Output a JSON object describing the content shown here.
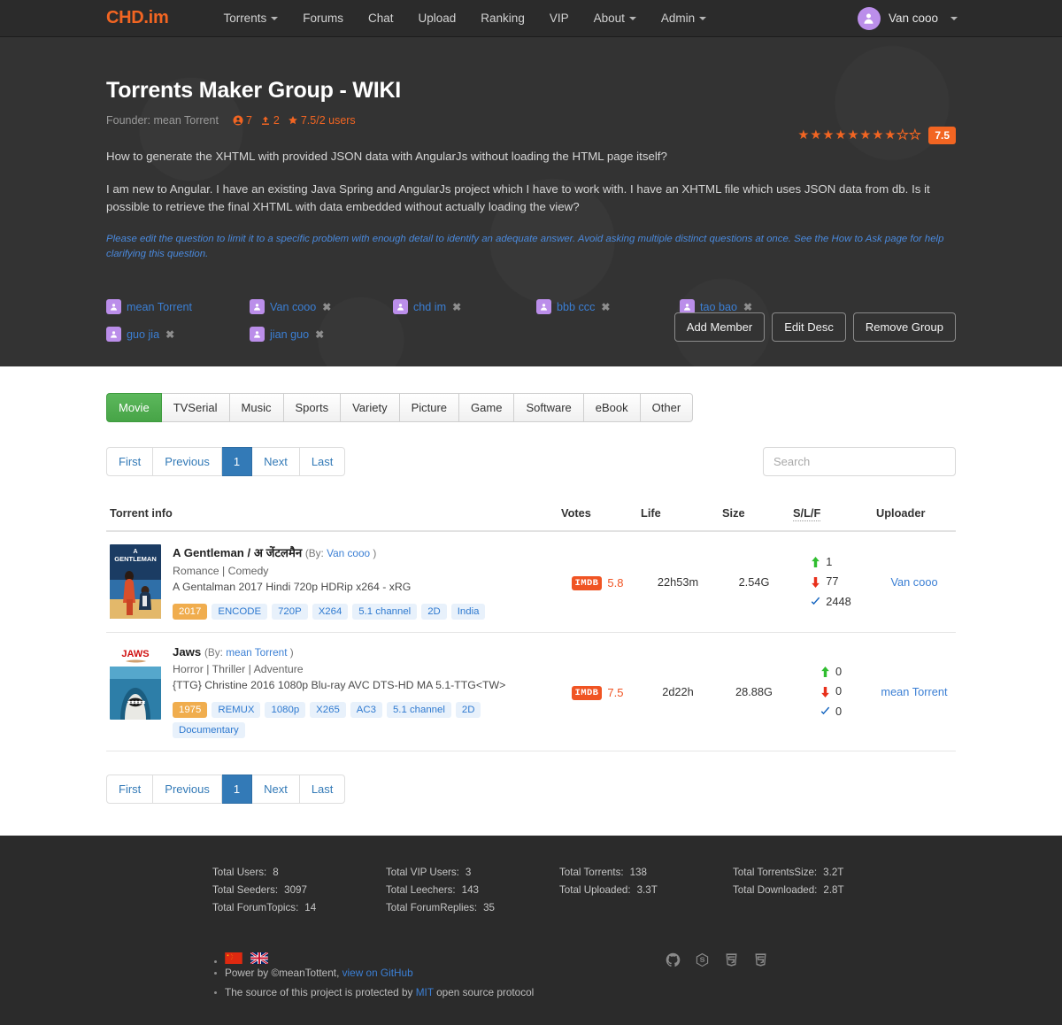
{
  "navbar": {
    "brand": "CHD.im",
    "links": [
      {
        "label": "Torrents",
        "caret": true
      },
      {
        "label": "Forums",
        "caret": false
      },
      {
        "label": "Chat",
        "caret": false
      },
      {
        "label": "Upload",
        "caret": false
      },
      {
        "label": "Ranking",
        "caret": false
      },
      {
        "label": "VIP",
        "caret": false
      },
      {
        "label": "About",
        "caret": true
      },
      {
        "label": "Admin",
        "caret": true
      }
    ],
    "user": "Van cooo",
    "user_icon": "user-icon",
    "accent_color": "#f26522"
  },
  "hero": {
    "title": "Torrents Maker Group - WIKI",
    "founder_label": "Founder: mean Torrent",
    "stats": [
      {
        "icon": "members-icon",
        "value": "7"
      },
      {
        "icon": "upload-icon",
        "value": "2"
      },
      {
        "icon": "star-icon",
        "value": "7.5/2 users"
      }
    ],
    "rating": {
      "filled": 8,
      "empty": 2,
      "score": "7.5"
    },
    "paragraph1": "How to generate the XHTML with provided JSON data with AngularJs without loading the HTML page itself?",
    "paragraph2": "I am new to Angular. I have an existing Java Spring and AngularJs project which I have to work with. I have an XHTML file which uses JSON data from db. Is it possible to retrieve the final XHTML with data embedded without actually loading the view?",
    "note": "Please edit the question to limit it to a specific problem with enough detail to identify an adequate answer. Avoid asking multiple distinct questions at once. See the How to Ask page for help clarifying this question.",
    "members": [
      {
        "name": "mean Torrent",
        "removable": false
      },
      {
        "name": "Van cooo",
        "removable": true
      },
      {
        "name": "chd im",
        "removable": true
      },
      {
        "name": "bbb ccc",
        "removable": true
      },
      {
        "name": "tao bao",
        "removable": true
      },
      {
        "name": "guo jia",
        "removable": true
      },
      {
        "name": "jian guo",
        "removable": true
      }
    ],
    "actions": [
      {
        "label": "Add Member"
      },
      {
        "label": "Edit Desc"
      },
      {
        "label": "Remove Group"
      }
    ]
  },
  "categories": {
    "tabs": [
      {
        "label": "Movie",
        "active": true
      },
      {
        "label": "TVSerial",
        "active": false
      },
      {
        "label": "Music",
        "active": false
      },
      {
        "label": "Sports",
        "active": false
      },
      {
        "label": "Variety",
        "active": false
      },
      {
        "label": "Picture",
        "active": false
      },
      {
        "label": "Game",
        "active": false
      },
      {
        "label": "Software",
        "active": false
      },
      {
        "label": "eBook",
        "active": false
      },
      {
        "label": "Other",
        "active": false
      }
    ]
  },
  "pager": [
    {
      "label": "First",
      "active": false
    },
    {
      "label": "Previous",
      "active": false
    },
    {
      "label": "1",
      "active": true
    },
    {
      "label": "Next",
      "active": false
    },
    {
      "label": "Last",
      "active": false
    }
  ],
  "search": {
    "placeholder": "Search",
    "value": ""
  },
  "table": {
    "headers": {
      "info": "Torrent info",
      "votes": "Votes",
      "life": "Life",
      "size": "Size",
      "slf": "S/L/F",
      "uploader": "Uploader"
    },
    "rows": [
      {
        "poster": "a-gentleman-poster",
        "title": "A Gentleman / अ जेंटलमैन",
        "by_prefix": "(By:",
        "by_user": "Van cooo",
        "by_suffix": ")",
        "genres": "Romance | Comedy",
        "filename": "A Gentalman 2017 Hindi 720p HDRip x264 - xRG",
        "tags": [
          "2017",
          "ENCODE",
          "720P",
          "X264",
          "5.1 channel",
          "2D",
          "India"
        ],
        "imdb_label": "IMDB",
        "imdb_score": "5.8",
        "life": "22h53m",
        "size": "2.54G",
        "seeders": "1",
        "leechers": "77",
        "finished": "2448",
        "uploader": "Van cooo"
      },
      {
        "poster": "jaws-poster",
        "title": "Jaws",
        "by_prefix": "(By:",
        "by_user": "mean Torrent",
        "by_suffix": ")",
        "genres": "Horror | Thriller | Adventure",
        "filename": "{TTG} Christine 2016 1080p Blu-ray AVC DTS-HD MA 5.1-TTG<TW>",
        "tags": [
          "1975",
          "REMUX",
          "1080p",
          "X265",
          "AC3",
          "5.1 channel",
          "2D",
          "Documentary"
        ],
        "imdb_label": "IMDB",
        "imdb_score": "7.5",
        "life": "2d22h",
        "size": "28.88G",
        "seeders": "0",
        "leechers": "0",
        "finished": "0",
        "uploader": "mean Torrent"
      }
    ]
  },
  "footer": {
    "stats": [
      [
        {
          "label": "Total Users:",
          "value": "8"
        },
        {
          "label": "Total Seeders:",
          "value": "3097"
        },
        {
          "label": "Total ForumTopics:",
          "value": "14"
        }
      ],
      [
        {
          "label": "Total VIP Users:",
          "value": "3"
        },
        {
          "label": "Total Leechers:",
          "value": "143"
        },
        {
          "label": "Total ForumReplies:",
          "value": "35"
        }
      ],
      [
        {
          "label": "Total Torrents:",
          "value": "138"
        },
        {
          "label": "Total Uploaded:",
          "value": "3.3T"
        }
      ],
      [
        {
          "label": "Total TorrentsSize:",
          "value": "3.2T"
        },
        {
          "label": "Total Downloaded:",
          "value": "2.8T"
        }
      ]
    ],
    "flags": [
      "china-flag-icon",
      "uk-flag-icon"
    ],
    "power_text": "Power by ©meanTottent,",
    "github_link": "view on GitHub",
    "license_pre": "The source of this project is protected by",
    "license_link": "MIT",
    "license_post": "open source protocol",
    "tech_icons": [
      "github-icon",
      "nodejs-icon",
      "html5-icon",
      "css3-icon"
    ]
  }
}
